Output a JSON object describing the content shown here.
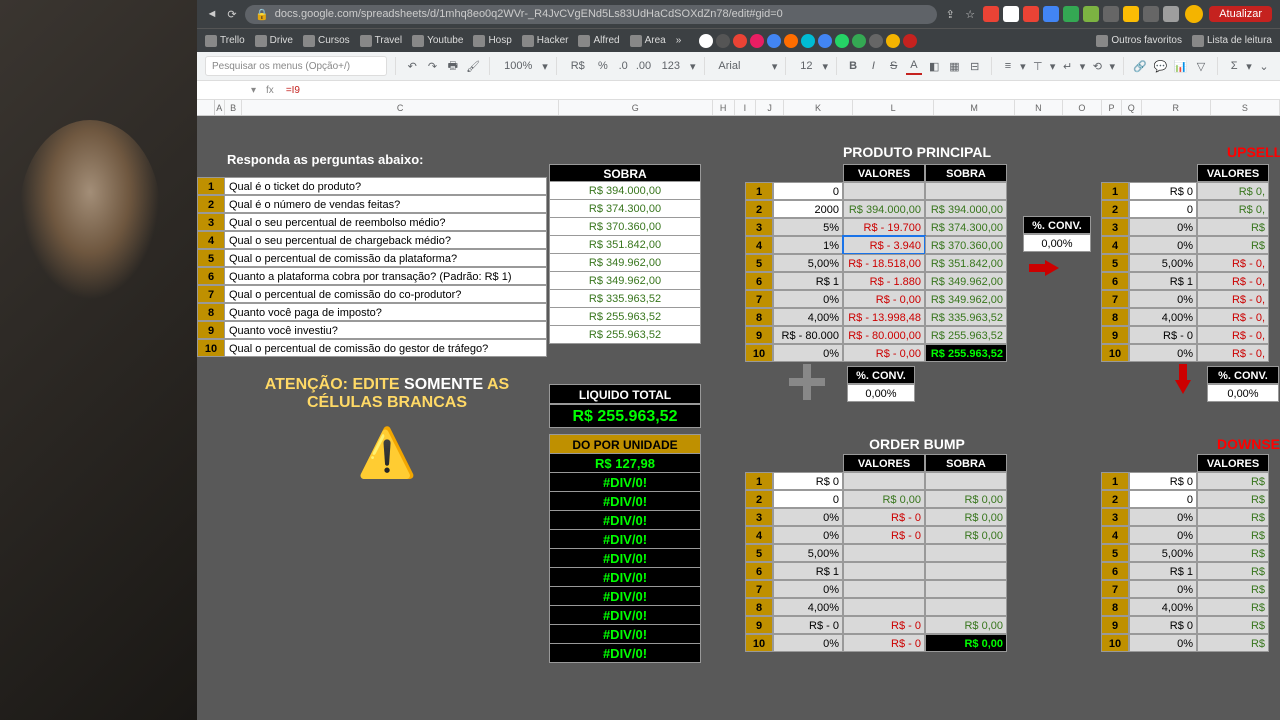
{
  "browser": {
    "url": "docs.google.com/spreadsheets/d/1mhq8eo0q2WVr-_R4JvCVgENd5Ls83UdHaCdSOXdZn78/edit#gid=0",
    "update_btn": "Atualizar",
    "bookmarks": [
      "Trello",
      "Drive",
      "Cursos",
      "Travel",
      "Youtube",
      "Hosp",
      "Hacker",
      "Alfred",
      "Area"
    ],
    "bm_right": [
      "Outros favoritos",
      "Lista de leitura"
    ]
  },
  "toolbar": {
    "search_placeholder": "Pesquisar os menus (Opção+/)",
    "zoom": "100%",
    "currency": "R$",
    "decimals": "123",
    "font": "Arial",
    "fontsize": "12"
  },
  "formula": {
    "fx": "fx",
    "value": "=I9"
  },
  "columns": [
    "A",
    "B",
    "C",
    "G",
    "H",
    "I",
    "J",
    "K",
    "L",
    "M",
    "N",
    "O",
    "P",
    "Q",
    "R",
    "S"
  ],
  "questions": {
    "title": "Responda as perguntas abaixo:",
    "items": [
      {
        "n": "1",
        "q": "Qual é o ticket do produto?"
      },
      {
        "n": "2",
        "q": "Qual é o número de vendas feitas?"
      },
      {
        "n": "3",
        "q": "Qual o seu percentual de reembolso médio?"
      },
      {
        "n": "4",
        "q": "Qual o seu percentual de chargeback médio?"
      },
      {
        "n": "5",
        "q": "Qual o percentual de comissão da plataforma?"
      },
      {
        "n": "6",
        "q": "Quanto a plataforma cobra por transação? (Padrão: R$ 1)"
      },
      {
        "n": "7",
        "q": "Qual o percentual de comissão do co-produtor?"
      },
      {
        "n": "8",
        "q": "Quanto você paga de imposto?"
      },
      {
        "n": "9",
        "q": "Quanto você investiu?"
      },
      {
        "n": "10",
        "q": "Qual o percentual de comissão do gestor de tráfego?"
      }
    ]
  },
  "sobra": {
    "header": "SOBRA",
    "rows": [
      "",
      "R$ 394.000,00",
      "R$ 374.300,00",
      "R$ 370.360,00",
      "R$ 351.842,00",
      "R$ 349.962,00",
      "R$ 349.962,00",
      "R$ 335.963,52",
      "R$ 255.963,52",
      "R$ 255.963,52"
    ]
  },
  "attention": {
    "l1a": "ATENÇÃO: EDITE",
    "l1b": "SOMENTE",
    "l1c": "AS",
    "l2": "CÉLULAS BRANCAS"
  },
  "liquido": {
    "label": "LIQUIDO TOTAL",
    "value": "R$ 255.963,52"
  },
  "unidade": {
    "label": "DO POR UNIDADE",
    "rows": [
      "R$ 127,98",
      "#DIV/0!",
      "#DIV/0!",
      "#DIV/0!",
      "#DIV/0!",
      "#DIV/0!",
      "#DIV/0!",
      "#DIV/0!",
      "#DIV/0!",
      "#DIV/0!",
      "#DIV/0!"
    ]
  },
  "principal": {
    "title": "PRODUTO PRINCIPAL",
    "headers": {
      "valores": "VALORES",
      "sobra": "SOBRA"
    },
    "rows": [
      {
        "n": "1",
        "in": "0",
        "val": "",
        "sob": ""
      },
      {
        "n": "2",
        "in": "2000",
        "val": "R$ 394.000,00",
        "sob": "R$ 394.000,00"
      },
      {
        "n": "3",
        "in": "5%",
        "val": "R$ - 19.700",
        "sob": "R$ 374.300,00"
      },
      {
        "n": "4",
        "in": "1%",
        "val": "R$ - 3.940",
        "sob": "R$ 370.360,00"
      },
      {
        "n": "5",
        "in": "5,00%",
        "val": "R$ - 18.518,00",
        "sob": "R$ 351.842,00"
      },
      {
        "n": "6",
        "in": "R$ 1",
        "val": "R$ - 1.880",
        "sob": "R$ 349.962,00"
      },
      {
        "n": "7",
        "in": "0%",
        "val": "R$ - 0,00",
        "sob": "R$ 349.962,00"
      },
      {
        "n": "8",
        "in": "4,00%",
        "val": "R$ - 13.998,48",
        "sob": "R$ 335.963,52"
      },
      {
        "n": "9",
        "in": "R$ - 80.000",
        "val": "R$ - 80.000,00",
        "sob": "R$ 255.963,52"
      },
      {
        "n": "10",
        "in": "0%",
        "val": "R$ - 0,00",
        "sob": "R$ 255.963,52"
      }
    ]
  },
  "upsell": {
    "title": "UPSELL",
    "headers": {
      "valores": "VALORES"
    },
    "rows": [
      {
        "n": "1",
        "in": "R$ 0",
        "val": "R$ 0,"
      },
      {
        "n": "2",
        "in": "0",
        "val": "R$ 0,"
      },
      {
        "n": "3",
        "in": "0%",
        "val": "R$"
      },
      {
        "n": "4",
        "in": "0%",
        "val": "R$"
      },
      {
        "n": "5",
        "in": "5,00%",
        "val": "R$ - 0,"
      },
      {
        "n": "6",
        "in": "R$ 1",
        "val": "R$ - 0,"
      },
      {
        "n": "7",
        "in": "0%",
        "val": "R$ - 0,"
      },
      {
        "n": "8",
        "in": "4,00%",
        "val": "R$ - 0,"
      },
      {
        "n": "9",
        "in": "R$ - 0",
        "val": "R$ - 0,"
      },
      {
        "n": "10",
        "in": "0%",
        "val": "R$ - 0,"
      }
    ]
  },
  "orderbump": {
    "title": "ORDER BUMP",
    "headers": {
      "valores": "VALORES",
      "sobra": "SOBRA"
    },
    "rows": [
      {
        "n": "1",
        "in": "R$ 0",
        "val": "",
        "sob": ""
      },
      {
        "n": "2",
        "in": "0",
        "val": "R$ 0,00",
        "sob": "R$ 0,00"
      },
      {
        "n": "3",
        "in": "0%",
        "val": "R$ - 0",
        "sob": "R$ 0,00"
      },
      {
        "n": "4",
        "in": "0%",
        "val": "R$ - 0",
        "sob": "R$ 0,00"
      },
      {
        "n": "5",
        "in": "5,00%",
        "val": "",
        "sob": ""
      },
      {
        "n": "6",
        "in": "R$ 1",
        "val": "",
        "sob": ""
      },
      {
        "n": "7",
        "in": "0%",
        "val": "",
        "sob": ""
      },
      {
        "n": "8",
        "in": "4,00%",
        "val": "",
        "sob": ""
      },
      {
        "n": "9",
        "in": "R$ - 0",
        "val": "R$ - 0",
        "sob": "R$ 0,00"
      },
      {
        "n": "10",
        "in": "0%",
        "val": "R$ - 0",
        "sob": "R$ 0,00"
      }
    ]
  },
  "downsell": {
    "title": "DOWNSELL",
    "headers": {
      "valores": "VALORES"
    },
    "rows": [
      {
        "n": "1",
        "in": "R$ 0",
        "val": "R$"
      },
      {
        "n": "2",
        "in": "0",
        "val": "R$"
      },
      {
        "n": "3",
        "in": "0%",
        "val": "R$"
      },
      {
        "n": "4",
        "in": "0%",
        "val": "R$"
      },
      {
        "n": "5",
        "in": "5,00%",
        "val": "R$"
      },
      {
        "n": "6",
        "in": "R$ 1",
        "val": "R$"
      },
      {
        "n": "7",
        "in": "0%",
        "val": "R$"
      },
      {
        "n": "8",
        "in": "4,00%",
        "val": "R$"
      },
      {
        "n": "9",
        "in": "R$ 0",
        "val": "R$"
      },
      {
        "n": "10",
        "in": "0%",
        "val": "R$"
      }
    ]
  },
  "conv": {
    "label": "%. CONV.",
    "value": "0,00%"
  }
}
